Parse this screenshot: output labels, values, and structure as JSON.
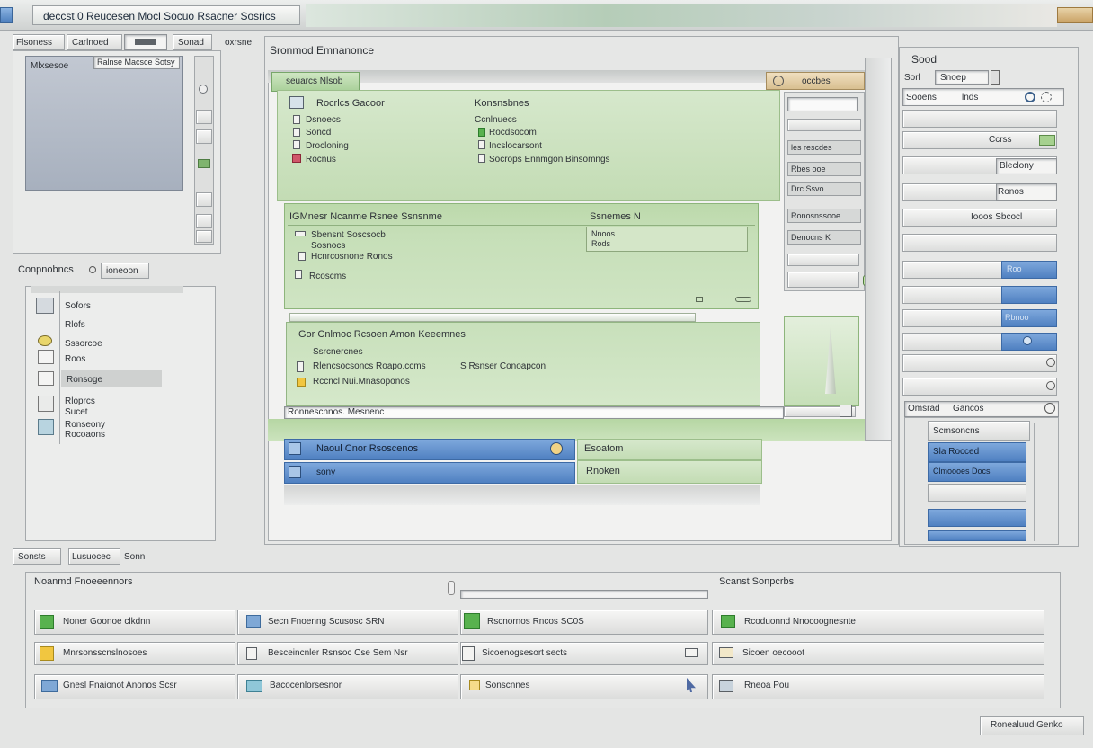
{
  "window": {
    "title": "deccst 0   Reucesen Mocl Socuo Rsacner   Sosrics"
  },
  "toolbar": {
    "tab_left": "Flsoness",
    "tab_mid": "Carlnoed",
    "tab_right": "Sonad",
    "tab_right2": "oxrsne"
  },
  "left_panel": {
    "preview_label": "Mlxsesoe",
    "preview_field": "Ralnse Macsce Sotsy",
    "group_label": "Conpnobncs",
    "group_button": "ioneoon",
    "items": [
      {
        "label": "Sofors",
        "icon": "image-icon"
      },
      {
        "label": "Rlofs",
        "icon": "blank-icon"
      },
      {
        "label": "Sssorcoe",
        "icon": "circle-icon"
      },
      {
        "label": "Roos",
        "icon": "blank-icon"
      },
      {
        "label": "Ronsoge",
        "icon": "blank-icon"
      },
      {
        "label": "Rloprcs",
        "icon": "list-icon"
      },
      {
        "label": "Sucet",
        "icon": "list-icon"
      },
      {
        "label": "Ronseony",
        "icon": "square-icon"
      },
      {
        "label": "Rocoaons",
        "icon": "square-icon"
      }
    ]
  },
  "center": {
    "header": "Sronmod Emnanonce",
    "tab_active": "seuarcs Nlsob",
    "tab_right": "occbes",
    "section1": {
      "title_left": "Rocrlcs Gacoor",
      "title_right": "Konsnsbnes",
      "left_items": [
        "Dsnoecs",
        "Soncd",
        "Drocloning",
        "Rocnus"
      ],
      "right_items": [
        "Ccnlnuecs",
        "Rocdsocom",
        "Incslocarsont",
        "Socrops Ennmgon Binsomngs"
      ]
    },
    "section2": {
      "title_left": "IGMnesr Ncanme Rsnee Ssnsnme",
      "title_right": "Ssnemes N",
      "left_items": [
        "Sbensnt Soscsocb",
        "Sosnocs",
        "Hcnrcosnone Ronos",
        "Rcoscms"
      ],
      "right_items": [
        "Nnoos",
        "Rods"
      ]
    },
    "section3": {
      "title": "Gor Cnlmoc Rcsoen  Amon Keeemnes",
      "left_items": [
        "Ssrcnercnes",
        "Rlencsocsoncs Roapo.ccms",
        "Rccncl Nui.Mnasoponos"
      ],
      "right_item": "S Rsnser Conoapcon"
    },
    "address_bar": "Ronnescnnos. Mesnenc",
    "bottom_bars": [
      {
        "label": "Naoul Cnor Rsoscenos",
        "side": "Esoatom"
      },
      {
        "label": "sony",
        "side": "Rnoken"
      }
    ]
  },
  "center_side_list": {
    "fields": [
      "",
      "",
      "les rescdes",
      "Rbes ooe",
      "Drc Ssvo",
      "Disanoe",
      "Ronosnssooe",
      "Denocns K",
      "",
      ""
    ]
  },
  "right_panel": {
    "title": "Sood",
    "tabs": [
      "Sorl",
      "Snoep"
    ],
    "search_label": "Sooens",
    "search_value": "lnds",
    "fields": [
      {
        "label": "",
        "value": ""
      },
      {
        "label": "",
        "value": "Ccrss"
      },
      {
        "label": "",
        "value": "Bleclony"
      },
      {
        "label": "",
        "value": "Ronos"
      },
      {
        "label": "",
        "value": "Iooos Sbcocl"
      },
      {
        "label": "",
        "value": ""
      },
      {
        "label": "",
        "value": "Roo"
      },
      {
        "label": "",
        "value": ""
      },
      {
        "label": "",
        "value": "Rbnoo"
      },
      {
        "label": "",
        "value": ""
      },
      {
        "label": "",
        "value": ""
      }
    ],
    "sub_title": "Omsrad",
    "sub_title2": "Gancos",
    "sub_header": "Scmsoncns",
    "sub_items": [
      "Sla    Rocced",
      "Clmoooes Docs",
      "",
      ""
    ]
  },
  "status_tabs": {
    "left": "Sonsts",
    "mid": "Lusuocec",
    "right": "Sonn"
  },
  "bottom_panel": {
    "title_left": "Noanmd Fnoeeennors",
    "title_right": "Scanst Sonpcrbs",
    "grid": [
      [
        {
          "label": "Noner Goonoe clkdnn",
          "icon": "image-icon"
        },
        {
          "label": "Secn Fnoenng  Scusosc   SRN",
          "icon": "image-icon"
        },
        {
          "label": "Rscnornos  Rncos  SC0S",
          "icon": "chart-icon"
        },
        {
          "label": "Rcoduonnd Nnocoognesnte",
          "icon": "image-icon"
        }
      ],
      [
        {
          "label": "Mnrsonsscnslnosoes",
          "icon": "folder-icon"
        },
        {
          "label": "Besceincnler Rsnsoc Cse Sem Nsr",
          "icon": "document-icon"
        },
        {
          "label": "Sicoenogsesort sects",
          "icon": "document-icon"
        },
        {
          "label": "Sicoen oecooot",
          "icon": "folder-icon"
        }
      ],
      [
        {
          "label": "Gnesl Fnaionot Anonos Scsr",
          "icon": "monitor-icon"
        },
        {
          "label": "Bacocenlorsesnor",
          "icon": "card-icon"
        },
        {
          "label": "Sonscnnes",
          "icon": "folder-icon"
        },
        {
          "label": "Rneoa Pou",
          "icon": "image-icon"
        }
      ]
    ],
    "footer_button": "Ronealuud Genko"
  },
  "colors": {
    "accent_green": "#c3dcb4",
    "accent_blue": "#5a8bcb",
    "background": "#e4e5e4"
  }
}
